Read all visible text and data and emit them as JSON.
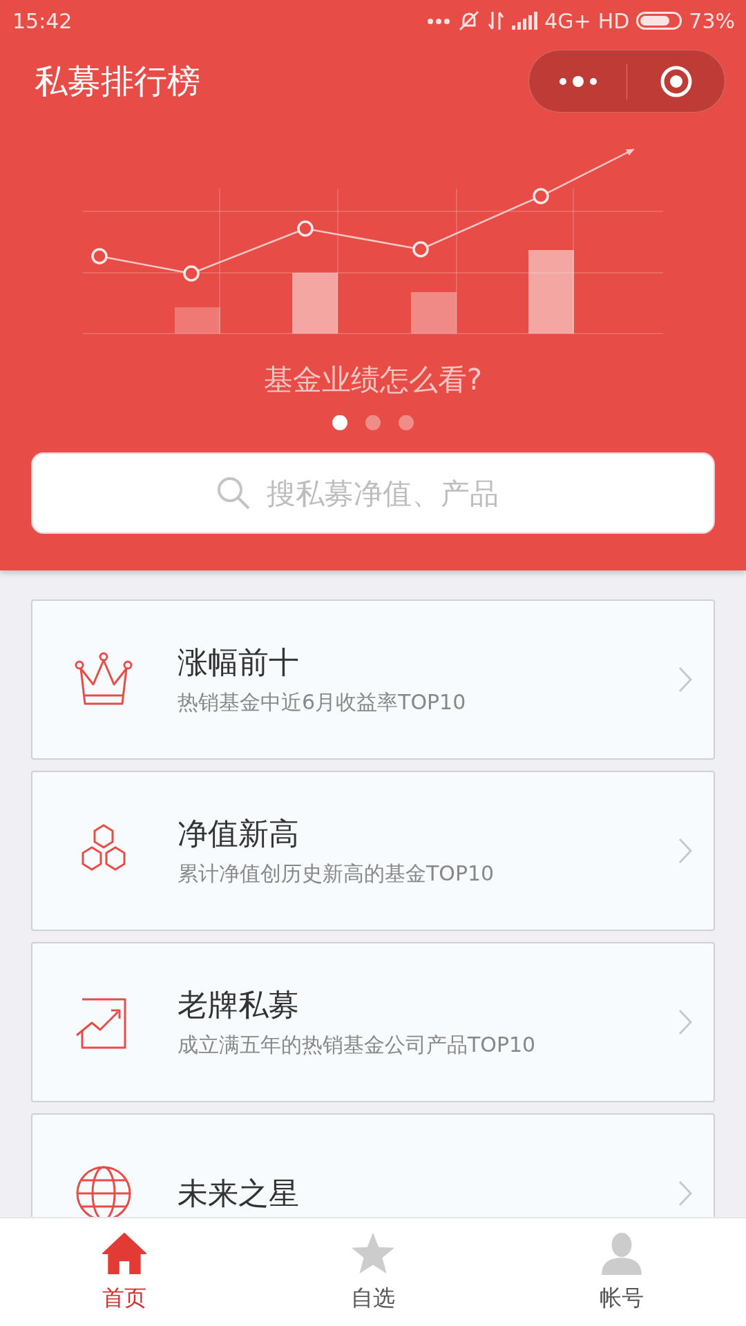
{
  "status_bar": {
    "time": "15:42",
    "network": "4G+",
    "hd": "HD",
    "battery": "73%"
  },
  "header": {
    "title": "私募排行榜"
  },
  "banner": {
    "caption": "基金业绩怎么看?",
    "pages": [
      {
        "selected": true
      },
      {
        "selected": false
      },
      {
        "selected": false
      }
    ]
  },
  "search": {
    "placeholder": "搜私募净值、产品"
  },
  "cards": [
    {
      "kind": "crown",
      "title": "涨幅前十",
      "subtitle": "热销基金中近6月收益率TOP10"
    },
    {
      "kind": "hexagons",
      "title": "净值新高",
      "subtitle": "累计净值创历史新高的基金TOP10"
    },
    {
      "kind": "trend",
      "title": "老牌私募",
      "subtitle": "成立满五年的热销基金公司产品TOP10"
    },
    {
      "kind": "globe",
      "title": "未来之星"
    }
  ],
  "tab_bar": [
    {
      "kind": "home",
      "label": "首页",
      "selected": true
    },
    {
      "kind": "star",
      "label": "自选",
      "selected": false
    },
    {
      "kind": "person",
      "label": "帐号",
      "selected": false
    }
  ]
}
